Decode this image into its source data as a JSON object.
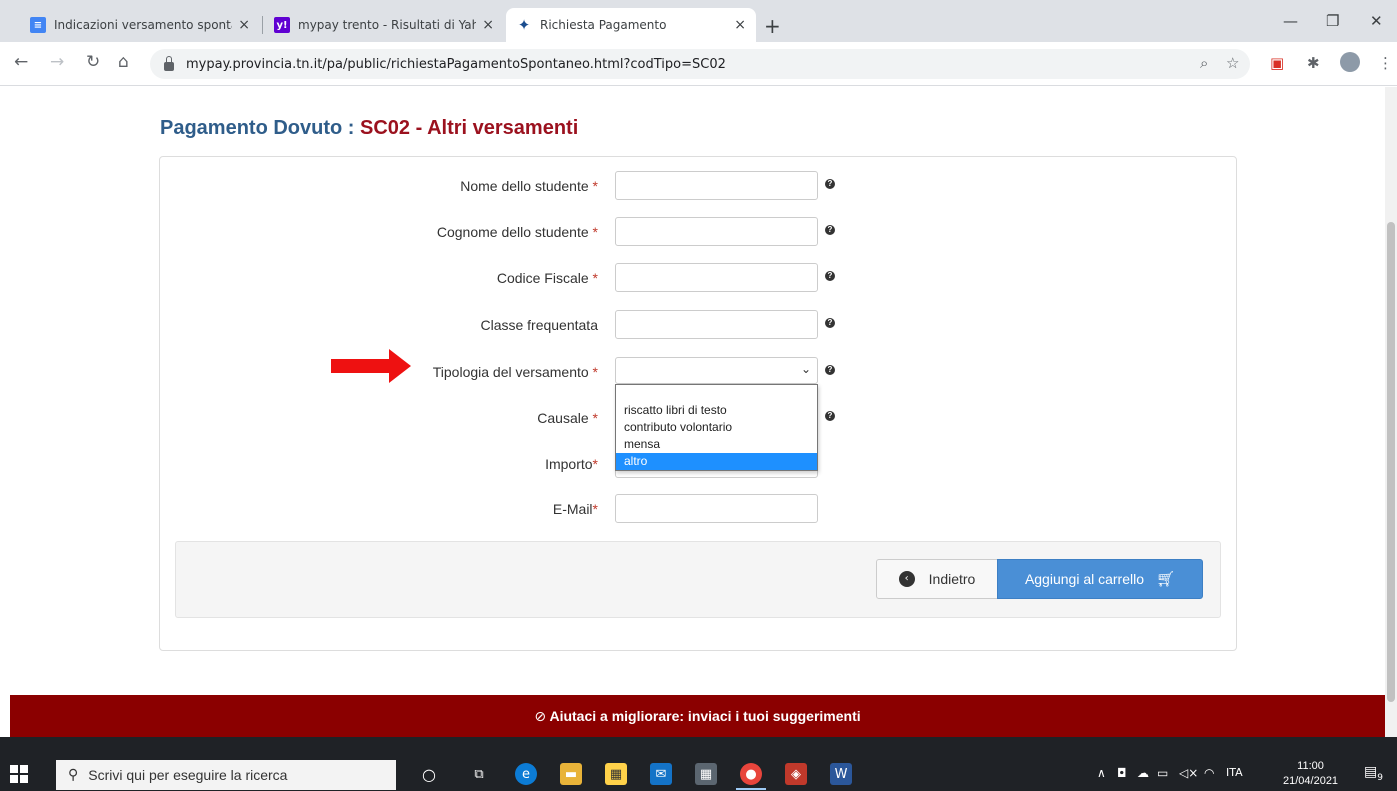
{
  "browser": {
    "tabs": [
      {
        "title": "Indicazioni versamento spontane",
        "icon": "google-docs-icon",
        "color": "#4285f4"
      },
      {
        "title": "mypay trento - Risultati di Yahoo",
        "icon": "yahoo-icon",
        "color": "#6001d2"
      },
      {
        "title": "Richiesta Pagamento",
        "icon": "mypay-icon",
        "color": "#1a4d8f"
      }
    ],
    "tab_close": "×",
    "new_tab": "+",
    "url": "mypay.provincia.tn.it/pa/public/richiestaPagamentoSpontaneo.html?codTipo=SC02"
  },
  "page": {
    "title_prefix": "Pagamento Dovuto : ",
    "title_code": "SC02 - Altri versamenti",
    "required_mark": "*",
    "fields": [
      {
        "label": "Nome dello studente",
        "required": " *",
        "type": "text",
        "value": ""
      },
      {
        "label": "Cognome dello studente",
        "required": " *",
        "type": "text",
        "value": ""
      },
      {
        "label": "Codice Fiscale",
        "required": " *",
        "type": "text",
        "value": ""
      },
      {
        "label": "Classe frequentata",
        "required": "",
        "type": "text",
        "value": ""
      },
      {
        "label": "Tipologia del versamento",
        "required": " *",
        "type": "select",
        "value": ""
      },
      {
        "label": "Causale",
        "required": " *",
        "type": "text",
        "value": ""
      },
      {
        "label": "Importo",
        "required": "*",
        "type": "text",
        "value": ""
      },
      {
        "label": "E-Mail",
        "required": "*",
        "type": "text",
        "value": ""
      }
    ],
    "help_glyph": "?",
    "dropdown_options": [
      "riscatto libri di testo",
      "contributo volontario",
      "mensa",
      "altro"
    ],
    "dropdown_highlighted": "altro",
    "back_button": "Indietro",
    "add_button": "Aggiungi al carrello",
    "banner_icon": "⊘",
    "banner_text": "Aiutaci a migliorare: inviaci i tuoi suggerimenti"
  },
  "taskbar": {
    "search_placeholder": "Scrivi qui per eseguire la ricerca",
    "language": "ITA",
    "time": "11:00",
    "date": "21/04/2021",
    "notifications": "9"
  },
  "colors": {
    "title_blue": "#2f5d8a",
    "title_red": "#9b111e",
    "primary_button": "#4a8fd6",
    "banner": "#8b0000",
    "arrow": "#ee1111"
  }
}
